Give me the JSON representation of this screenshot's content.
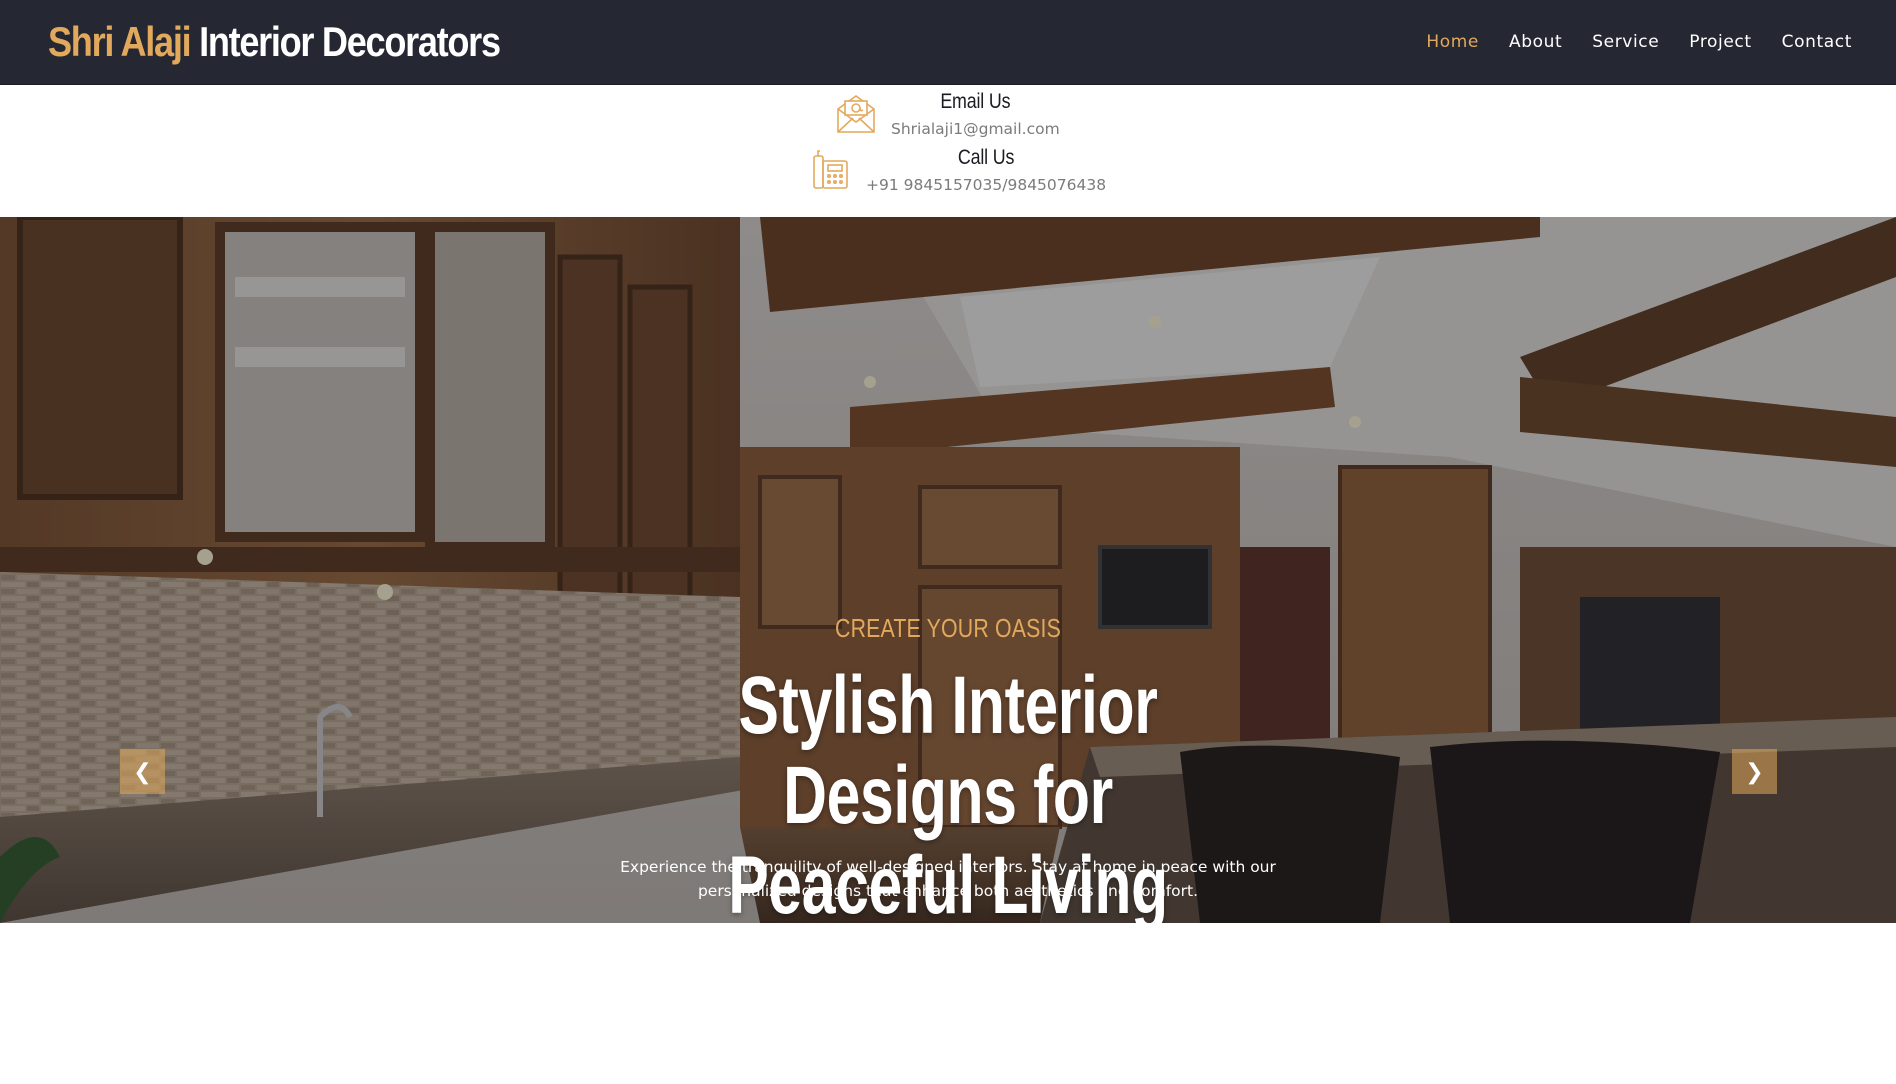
{
  "brand": {
    "accent": "Shri Alaji",
    "rest": "Interior Decorators"
  },
  "nav": {
    "home": "Home",
    "about": "About",
    "service": "Service",
    "project": "Project",
    "contact": "Contact"
  },
  "contact": {
    "email_label": "Email Us",
    "email_value": "Shrialaji1@gmail.com",
    "call_label": "Call Us",
    "call_value": "+91 9845157035/9845076438"
  },
  "hero": {
    "kicker": "CREATE YOUR OASIS",
    "headline": "Stylish Interior Designs for Peaceful Living",
    "subtext": "Experience the tranquility of well-designed interiors. Stay at home in peace with our personalized designs that enhance both aesthetics and comfort.",
    "prev_icon": "chevron-left-icon",
    "next_icon": "chevron-right-icon"
  },
  "colors": {
    "accent": "#e2a95d",
    "navbar_bg": "#252833"
  }
}
